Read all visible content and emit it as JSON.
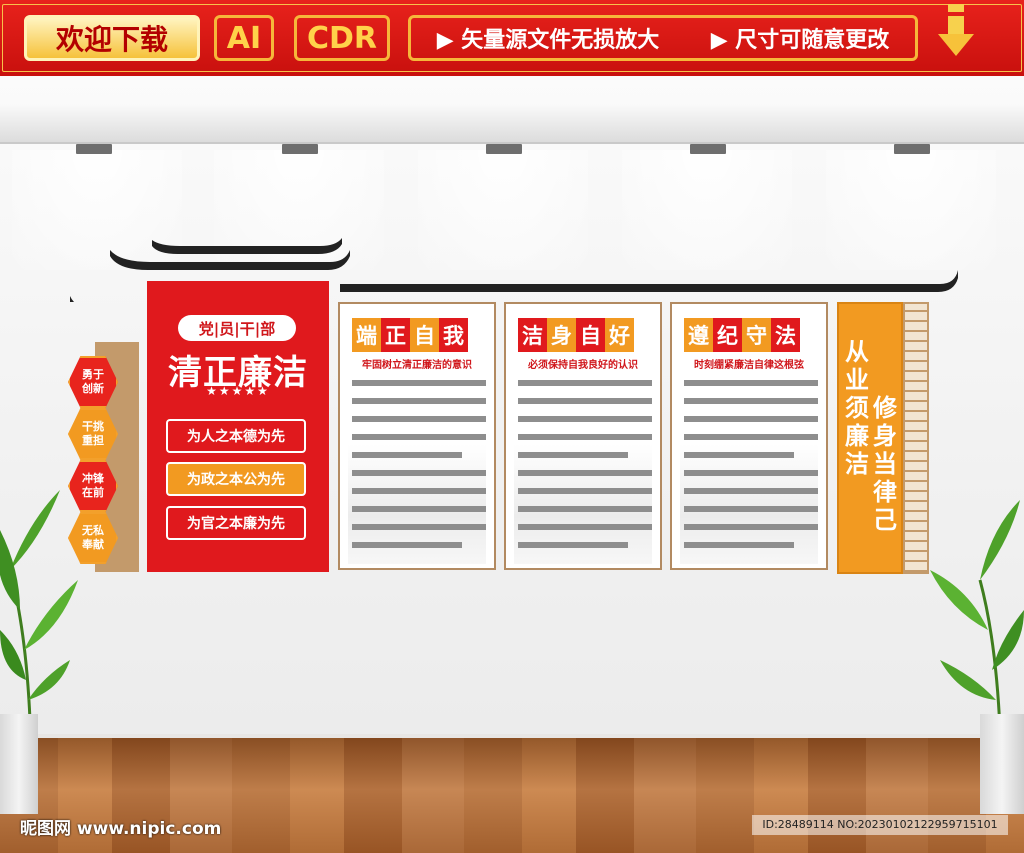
{
  "banner": {
    "download_label": "欢迎下载",
    "format_ai": "AI",
    "format_cdr": "CDR",
    "features": [
      "▶ 矢量源文件无损放大",
      "▶ 尺寸可随意更改"
    ]
  },
  "left_column": {
    "hexagons": [
      "勇于创新",
      "干挑重担",
      "冲锋在前",
      "无私奉献"
    ]
  },
  "red_panel": {
    "tag": "党|员|干|部",
    "title": "清正廉洁",
    "stars": "★★★★★",
    "slogans": [
      "为人之本德为先",
      "为政之本公为先",
      "为官之本廉为先"
    ]
  },
  "boards": [
    {
      "heading": [
        "端",
        "正",
        "自",
        "我"
      ],
      "subtitle": "牢固树立清正廉洁的意识"
    },
    {
      "heading": [
        "洁",
        "身",
        "自",
        "好"
      ],
      "subtitle": "必须保持自我良好的认识"
    },
    {
      "heading": [
        "遵",
        "纪",
        "守",
        "法"
      ],
      "subtitle": "时刻绷紧廉洁自律这根弦"
    }
  ],
  "orange_panel": {
    "col1": "从业须廉洁",
    "col2": "修身当律己"
  },
  "footer": {
    "logo": "昵图网 www.nipic.com",
    "id_text": "ID:28489114 NO:20230102122959715101"
  },
  "colors": {
    "red": "#e0191d",
    "orange": "#f29a21",
    "tan": "#c39a6b",
    "gold": "#f6b63a"
  }
}
